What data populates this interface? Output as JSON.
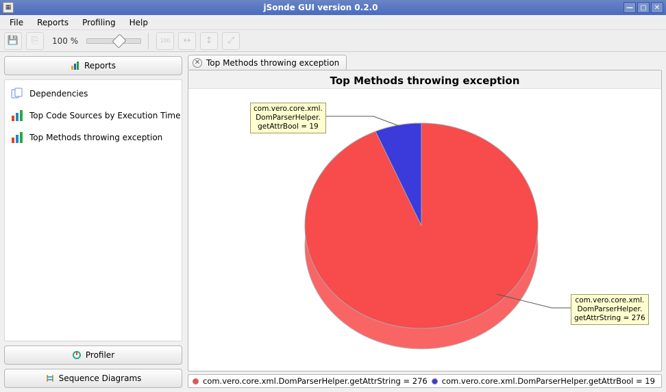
{
  "window": {
    "title": "jSonde GUI version 0.2.0"
  },
  "menu": {
    "file": "File",
    "reports": "Reports",
    "profiling": "Profiling",
    "help": "Help"
  },
  "toolbar": {
    "zoom_label": "100 %"
  },
  "sidebar": {
    "reports_btn": "Reports",
    "profiler_btn": "Profiler",
    "sequence_btn": "Sequence Diagrams",
    "items": [
      {
        "label": "Dependencies"
      },
      {
        "label": "Top Code Sources by Execution Time"
      },
      {
        "label": "Top Methods throwing exception"
      }
    ]
  },
  "tab": {
    "label": "Top Methods throwing exception"
  },
  "chart": {
    "title": "Top Methods throwing exception",
    "callout1_l1": "com.vero.core.xml.",
    "callout1_l2": "DomParserHelper.",
    "callout1_l3": "getAttrBool = 19",
    "callout2_l1": "com.vero.core.xml.",
    "callout2_l2": "DomParserHelper.",
    "callout2_l3": "getAttrString = 276"
  },
  "legend": {
    "item1": "com.vero.core.xml.DomParserHelper.getAttrString = 276",
    "item2": "com.vero.core.xml.DomParserHelper.getAttrBool = 19"
  },
  "chart_data": {
    "type": "pie",
    "title": "Top Methods throwing exception",
    "series": [
      {
        "name": "com.vero.core.xml.DomParserHelper.getAttrString",
        "value": 276,
        "color": "#f84b4b"
      },
      {
        "name": "com.vero.core.xml.DomParserHelper.getAttrBool",
        "value": 19,
        "color": "#3b3bdc"
      }
    ]
  }
}
